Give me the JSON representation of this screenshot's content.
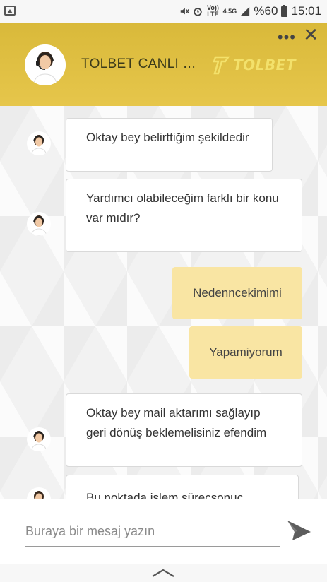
{
  "status_bar": {
    "network_top": "Vo)) LTE",
    "network_bottom": "4.5G",
    "battery_percent": "%60",
    "time": "15:01"
  },
  "header": {
    "title": "TOLBET CANLI DESTEK",
    "brand_name": "TOLBET",
    "more_icon": "more-dots-icon",
    "close_icon": "close-icon"
  },
  "messages": [
    {
      "direction": "in",
      "text": "Oktay bey belirttiğim şekildedir"
    },
    {
      "direction": "in",
      "text": "Yardımcı olabileceğim farklı bir konu var mıdır?"
    },
    {
      "direction": "out",
      "text": "Nedenncekimimi"
    },
    {
      "direction": "out",
      "text": "Yapamiyorum"
    },
    {
      "direction": "in",
      "text": "Oktay bey mail aktarımı sağlayıp geri dönüş beklemelisiniz efendim"
    },
    {
      "direction": "in",
      "text": "Bu noktada işlem süreçsonuç hakkında bilgi"
    }
  ],
  "composer": {
    "placeholder": "Buraya bir mesaj yazın",
    "send_icon": "send-icon"
  },
  "colors": {
    "header_gold": "#e0c042",
    "outgoing_bubble": "#f9e5a3",
    "incoming_bubble": "#ffffff"
  }
}
